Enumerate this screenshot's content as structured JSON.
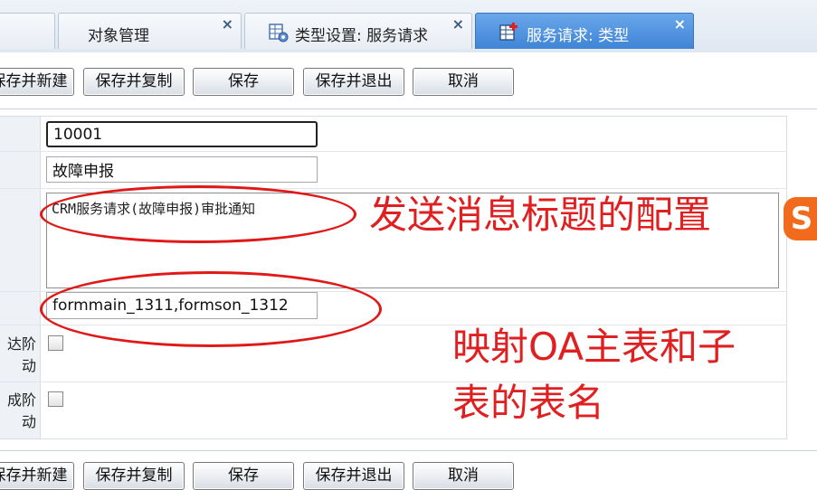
{
  "tabs": [
    {
      "label": ""
    },
    {
      "label": "对象管理",
      "close": "×"
    },
    {
      "label": "类型设置: 服务请求",
      "close": "×"
    },
    {
      "label": "服务请求: 类型",
      "close": "×"
    }
  ],
  "toolbar": {
    "save_new": "保存并新建",
    "save_copy": "保存并复制",
    "save": "保存",
    "save_exit": "保存并退出",
    "cancel": "取消"
  },
  "form": {
    "code_value": "10001",
    "name_value": "故障申报",
    "message_title": "CRM服务请求(故障申报)审批通知",
    "table_names": "formmain_1311,formson_1312",
    "row5_label_line1": "达阶",
    "row5_label_line2": "动",
    "row6_label_line1": "成阶",
    "row6_label_line2": "动"
  },
  "annotations": {
    "message_title_note": "发送消息标题的配置",
    "table_note_line1": "映射OA主表和子",
    "table_note_line2": "表的表名"
  },
  "colors": {
    "annotation_red": "#e02020",
    "active_tab": "#4a8fdd"
  },
  "icons": {
    "tab3_icon": "grid-settings-icon",
    "tab4_icon": "grid-add-icon",
    "ime_icon": "sogou-ime-icon"
  },
  "ime": {
    "label": "S"
  }
}
